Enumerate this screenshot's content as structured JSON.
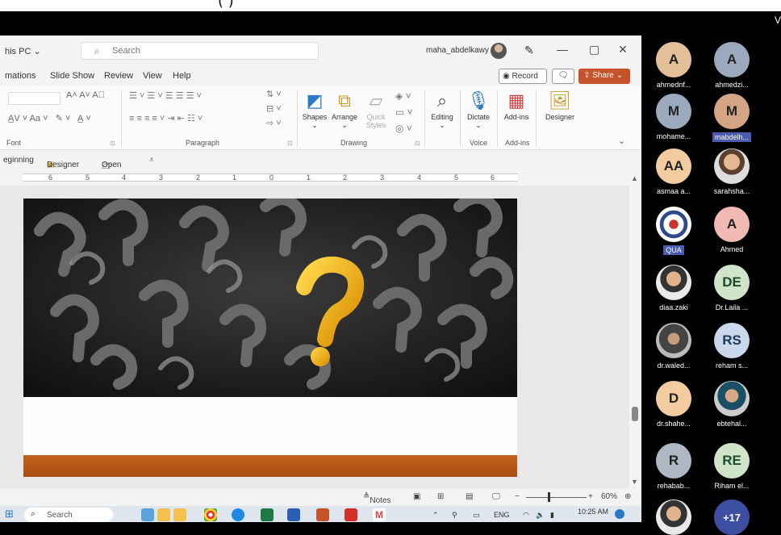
{
  "caption": "( ) ",
  "window": {
    "location": "his PC",
    "search_placeholder": "Search",
    "user_name": "maha_abdelkawy",
    "minimize": "—",
    "restore": "▢",
    "close": "✕"
  },
  "tabs": [
    "mations",
    "Slide Show",
    "Review",
    "View",
    "Help"
  ],
  "record_label": "Record",
  "share_label": "Share",
  "ribbon": {
    "groups": [
      "Font",
      "Paragraph",
      "Drawing",
      "Voice",
      "Add-ins"
    ],
    "buttons": {
      "shapes": "Shapes",
      "arrange": "Arrange",
      "quick_styles": "Quick Styles",
      "editing": "Editing",
      "dictate": "Dictate",
      "addins": "Add-ins",
      "designer": "Designer"
    }
  },
  "qat": {
    "beginning": "eginning",
    "designer": "Designer",
    "open": "Open"
  },
  "ruler_numbers": [
    "6",
    "5",
    "4",
    "3",
    "2",
    "1",
    "0",
    "1",
    "2",
    "3",
    "4",
    "5",
    "6"
  ],
  "statusbar": {
    "notes": "Notes",
    "zoom": "60%"
  },
  "taskbar": {
    "search": "Search",
    "lang": "ENG",
    "time": "10:25 AM"
  },
  "participants": [
    {
      "initials": "A",
      "name": "ahmednf...",
      "color": "#e3c09a",
      "text": "#222"
    },
    {
      "initials": "A",
      "name": "ahmedzi...",
      "color": "#9aa9bb",
      "text": "#222"
    },
    {
      "initials": "M",
      "name": "mohame...",
      "color": "#9aa9bb",
      "text": "#222"
    },
    {
      "initials": "M",
      "name": "mabdelh...",
      "color": "#d4a584",
      "text": "#222"
    },
    {
      "initials": "AA",
      "name": "asmaa a...",
      "color": "#f3cba0",
      "text": "#222"
    },
    {
      "initials": "",
      "name": "sarahsha...",
      "color": "",
      "text": "#222"
    },
    {
      "initials": "",
      "name": "QUA",
      "color": "#fff",
      "text": "#222"
    },
    {
      "initials": "A",
      "name": "Ahmed",
      "color": "#f0b9b4",
      "text": "#222"
    },
    {
      "initials": "",
      "name": "diaa.zaki",
      "color": "",
      "text": "#222"
    },
    {
      "initials": "DE",
      "name": "Dr.Laila ...",
      "color": "#cfe4c9",
      "text": "#1c4a2a"
    },
    {
      "initials": "",
      "name": "dr.waled...",
      "color": "",
      "text": "#222"
    },
    {
      "initials": "RS",
      "name": "reham s...",
      "color": "#c9d8ea",
      "text": "#1c3a5a"
    },
    {
      "initials": "D",
      "name": "dr.shahe...",
      "color": "#f3cba0",
      "text": "#222"
    },
    {
      "initials": "",
      "name": "ebtehal...",
      "color": "",
      "text": "#222"
    },
    {
      "initials": "R",
      "name": "rehabab...",
      "color": "#aeb8c3",
      "text": "#222"
    },
    {
      "initials": "RE",
      "name": "Riham el...",
      "color": "#cfe4c9",
      "text": "#1c4a2a"
    },
    {
      "initials": "",
      "name": "",
      "color": "",
      "text": "#222"
    },
    {
      "initials": "+17",
      "name": "",
      "color": "#3c4fa3",
      "text": "#fff"
    }
  ],
  "side_letter": "V"
}
